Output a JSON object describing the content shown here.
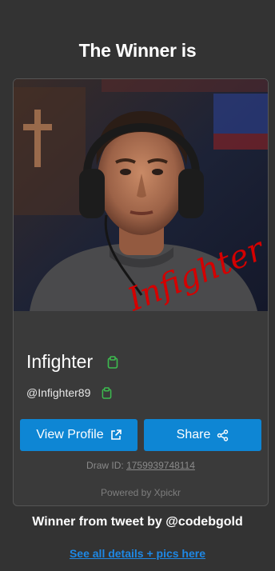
{
  "header": {
    "title": "The Winner is"
  },
  "winner": {
    "name": "Infighter",
    "handle": "@Infighter89",
    "signature": "Infighter"
  },
  "actions": {
    "view_profile_label": "View Profile",
    "share_label": "Share"
  },
  "draw": {
    "label": "Draw ID:",
    "id": "1759939748114"
  },
  "powered_by": "Powered by Xpickr",
  "tweet_credit": "Winner from tweet by @codebgold",
  "details_link": "See all details + pics here",
  "colors": {
    "background": "#333333",
    "card": "#3a3a3a",
    "button": "#0e86d4",
    "copy_icon": "#3dbb4f",
    "link": "#1e88e5",
    "signature": "#d40000"
  },
  "icons": {
    "copy": "clipboard-icon",
    "external": "external-link-icon",
    "share": "share-icon"
  }
}
